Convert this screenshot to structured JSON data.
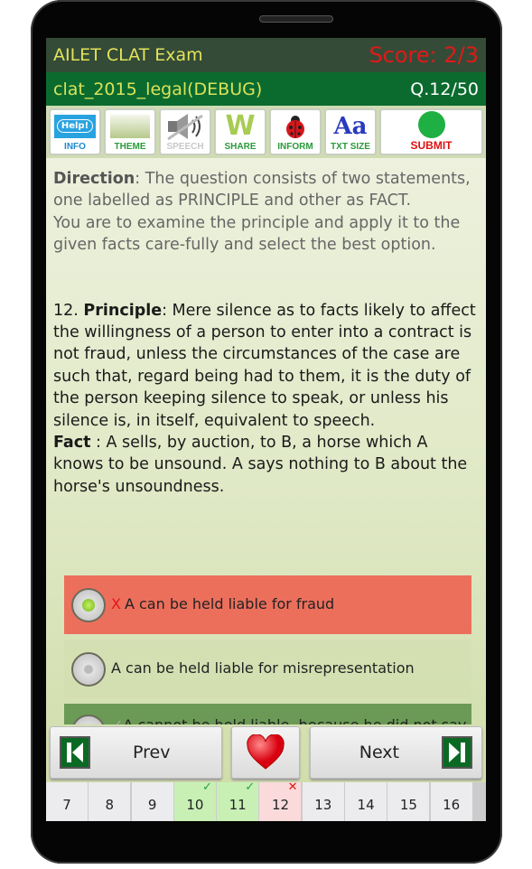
{
  "header": {
    "title": "AILET CLAT Exam",
    "score": "Score: 2/3",
    "subtitle": "clat_2015_legal(DEBUG)",
    "question_counter": "Q.12/50"
  },
  "toolbar": [
    {
      "label": "INFO",
      "icon": "help-bubble-icon",
      "icon_text": "Help!",
      "color": "#1e88d0"
    },
    {
      "label": "THEME",
      "icon": "theme-swatch-icon",
      "color": "#2a9a3a"
    },
    {
      "label": "SPEECH",
      "icon": "speaker-muted-icon",
      "color": "#c8c8c8"
    },
    {
      "label": "SHARE",
      "icon": "share-w-icon",
      "icon_text": "W",
      "color": "#2a9a3a"
    },
    {
      "label": "INFORM",
      "icon": "ladybug-icon",
      "color": "#2a9a3a"
    },
    {
      "label": "TXT SIZE",
      "icon": "text-size-icon",
      "icon_text": "Aa",
      "color": "#2a9a3a"
    },
    {
      "label": "SUBMIT",
      "icon": "green-circle-icon",
      "color": "#dd1111"
    }
  ],
  "direction": {
    "label": "Direction",
    "text": ": The question consists of two statements, one labelled as PRINCIPLE and other as FACT.",
    "text2": "You are to examine the principle and apply it to the given facts care-fully and select the best option."
  },
  "question": {
    "number": "12. ",
    "principle_label": "Principle",
    "principle_text": ": Mere silence as to facts likely to affect the willingness of a person to enter into a contract is not fraud, unless the circumstances of the case are such that, regard being had to them, it is the duty of the person keeping silence to speak, or unless his silence is, in itself, equivalent to speech.",
    "fact_label": "Fact",
    "fact_text": " : A sells, by auction, to B, a horse which A knows to be unsound. A says nothing to B about the horse's unsoundness."
  },
  "options": [
    {
      "mark": "X",
      "text": "A can be held liable for fraud",
      "state": "selected-wrong",
      "color": "#ec6f5c"
    },
    {
      "mark": "",
      "text": "A can be held liable for misrepresentation",
      "state": "unselected"
    },
    {
      "mark": "✓",
      "text": "A cannot be held liable, because he did not say",
      "state": "correct",
      "color": "#6a9a55"
    }
  ],
  "nav": {
    "prev": "Prev",
    "next": "Next",
    "favorite_icon": "heart-icon"
  },
  "question_strip": [
    {
      "n": "7",
      "status": ""
    },
    {
      "n": "8",
      "status": ""
    },
    {
      "n": "9",
      "status": ""
    },
    {
      "n": "10",
      "status": "correct",
      "mark": "✓"
    },
    {
      "n": "11",
      "status": "correct",
      "mark": "✓"
    },
    {
      "n": "12",
      "status": "wrong",
      "mark": "✕"
    },
    {
      "n": "13",
      "status": ""
    },
    {
      "n": "14",
      "status": ""
    },
    {
      "n": "15",
      "status": ""
    },
    {
      "n": "16",
      "status": ""
    }
  ]
}
